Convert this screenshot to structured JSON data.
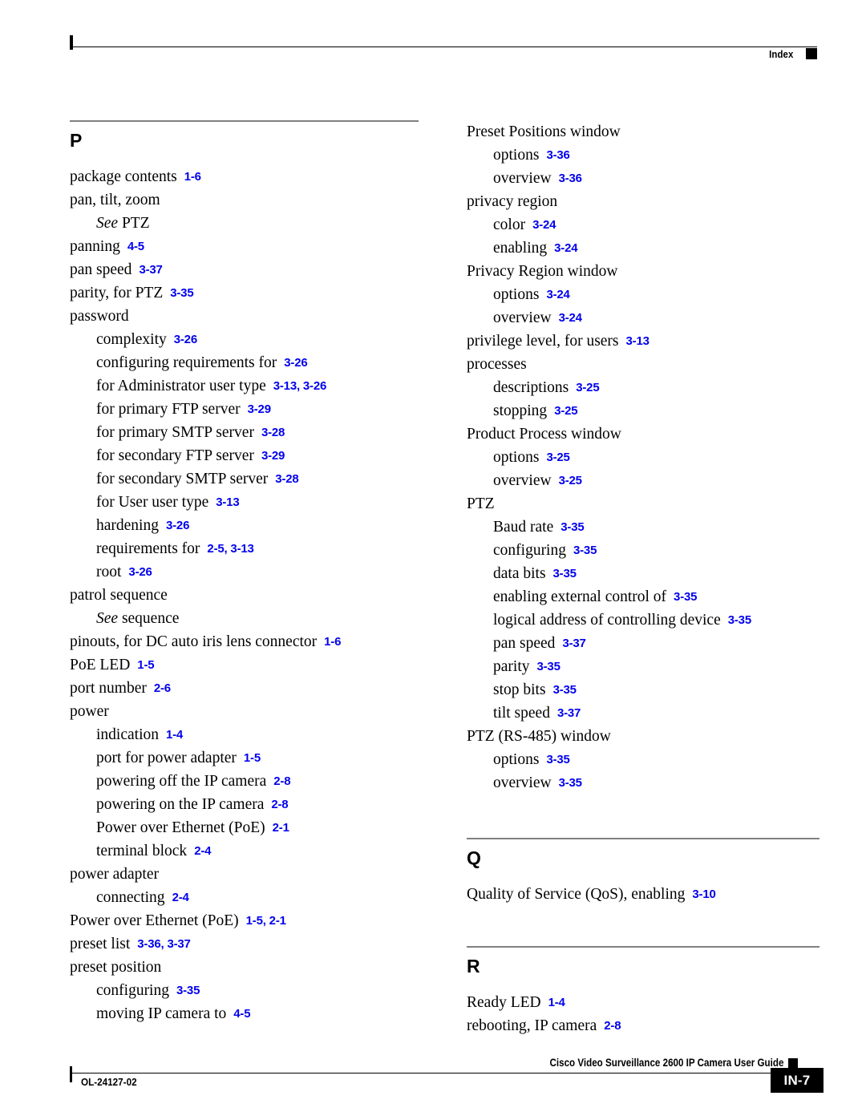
{
  "header": {
    "label": "Index"
  },
  "footer": {
    "doc_id": "OL-24127-02",
    "guide_title": "Cisco Video Surveillance 2600 IP Camera User Guide",
    "page_number": "IN-7"
  },
  "sections": {
    "p": {
      "letter": "P"
    },
    "q": {
      "letter": "Q"
    },
    "r": {
      "letter": "R"
    }
  },
  "left_column": [
    {
      "level": 1,
      "term": "package contents",
      "refs": "1-6"
    },
    {
      "level": 1,
      "term": "pan, tilt, zoom",
      "refs": ""
    },
    {
      "level": 2,
      "see": "See",
      "term": "PTZ",
      "refs": ""
    },
    {
      "level": 1,
      "term": "panning",
      "refs": "4-5"
    },
    {
      "level": 1,
      "term": "pan speed",
      "refs": "3-37"
    },
    {
      "level": 1,
      "term": "parity, for PTZ",
      "refs": "3-35"
    },
    {
      "level": 1,
      "term": "password",
      "refs": ""
    },
    {
      "level": 2,
      "term": "complexity",
      "refs": "3-26"
    },
    {
      "level": 2,
      "term": "configuring requirements for",
      "refs": "3-26"
    },
    {
      "level": 2,
      "term": "for Administrator user type",
      "refs": "3-13, 3-26"
    },
    {
      "level": 2,
      "term": "for primary FTP server",
      "refs": "3-29"
    },
    {
      "level": 2,
      "term": "for primary SMTP server",
      "refs": "3-28"
    },
    {
      "level": 2,
      "term": "for secondary FTP server",
      "refs": "3-29"
    },
    {
      "level": 2,
      "term": "for secondary SMTP server",
      "refs": "3-28"
    },
    {
      "level": 2,
      "term": "for User user type",
      "refs": "3-13"
    },
    {
      "level": 2,
      "term": "hardening",
      "refs": "3-26"
    },
    {
      "level": 2,
      "term": "requirements for",
      "refs": "2-5, 3-13"
    },
    {
      "level": 2,
      "term": "root",
      "refs": "3-26"
    },
    {
      "level": 1,
      "term": "patrol sequence",
      "refs": ""
    },
    {
      "level": 2,
      "see": "See",
      "term": "sequence",
      "refs": ""
    },
    {
      "level": 1,
      "term": "pinouts, for DC auto iris lens connector",
      "refs": "1-6"
    },
    {
      "level": 1,
      "term": "PoE LED",
      "refs": "1-5"
    },
    {
      "level": 1,
      "term": "port number",
      "refs": "2-6"
    },
    {
      "level": 1,
      "term": "power",
      "refs": ""
    },
    {
      "level": 2,
      "term": "indication",
      "refs": "1-4"
    },
    {
      "level": 2,
      "term": "port for power adapter",
      "refs": "1-5"
    },
    {
      "level": 2,
      "term": "powering off the IP camera",
      "refs": "2-8"
    },
    {
      "level": 2,
      "term": "powering on the IP camera",
      "refs": "2-8"
    },
    {
      "level": 2,
      "term": "Power over Ethernet (PoE)",
      "refs": "2-1"
    },
    {
      "level": 2,
      "term": "terminal block",
      "refs": "2-4"
    },
    {
      "level": 1,
      "term": "power adapter",
      "refs": ""
    },
    {
      "level": 2,
      "term": "connecting",
      "refs": "2-4"
    },
    {
      "level": 1,
      "term": "Power over Ethernet (PoE)",
      "refs": "1-5, 2-1"
    },
    {
      "level": 1,
      "term": "preset list",
      "refs": "3-36, 3-37"
    },
    {
      "level": 1,
      "term": "preset position",
      "refs": ""
    },
    {
      "level": 2,
      "term": "configuring",
      "refs": "3-35"
    },
    {
      "level": 2,
      "term": "moving IP camera to",
      "refs": "4-5"
    }
  ],
  "right_column_p": [
    {
      "level": 1,
      "term": "Preset Positions window",
      "refs": ""
    },
    {
      "level": 2,
      "term": "options",
      "refs": "3-36"
    },
    {
      "level": 2,
      "term": "overview",
      "refs": "3-36"
    },
    {
      "level": 1,
      "term": "privacy region",
      "refs": ""
    },
    {
      "level": 2,
      "term": "color",
      "refs": "3-24"
    },
    {
      "level": 2,
      "term": "enabling",
      "refs": "3-24"
    },
    {
      "level": 1,
      "term": "Privacy Region window",
      "refs": ""
    },
    {
      "level": 2,
      "term": "options",
      "refs": "3-24"
    },
    {
      "level": 2,
      "term": "overview",
      "refs": "3-24"
    },
    {
      "level": 1,
      "term": "privilege level, for users",
      "refs": "3-13"
    },
    {
      "level": 1,
      "term": "processes",
      "refs": ""
    },
    {
      "level": 2,
      "term": "descriptions",
      "refs": "3-25"
    },
    {
      "level": 2,
      "term": "stopping",
      "refs": "3-25"
    },
    {
      "level": 1,
      "term": "Product Process window",
      "refs": ""
    },
    {
      "level": 2,
      "term": "options",
      "refs": "3-25"
    },
    {
      "level": 2,
      "term": "overview",
      "refs": "3-25"
    },
    {
      "level": 1,
      "term": "PTZ",
      "refs": ""
    },
    {
      "level": 2,
      "term": "Baud rate",
      "refs": "3-35"
    },
    {
      "level": 2,
      "term": "configuring",
      "refs": "3-35"
    },
    {
      "level": 2,
      "term": "data bits",
      "refs": "3-35"
    },
    {
      "level": 2,
      "term": "enabling external control of",
      "refs": "3-35"
    },
    {
      "level": 2,
      "term": "logical address of controlling device",
      "refs": "3-35"
    },
    {
      "level": 2,
      "term": "pan speed",
      "refs": "3-37"
    },
    {
      "level": 2,
      "term": "parity",
      "refs": "3-35"
    },
    {
      "level": 2,
      "term": "stop bits",
      "refs": "3-35"
    },
    {
      "level": 2,
      "term": "tilt speed",
      "refs": "3-37"
    },
    {
      "level": 1,
      "term": "PTZ (RS-485) window",
      "refs": ""
    },
    {
      "level": 2,
      "term": "options",
      "refs": "3-35"
    },
    {
      "level": 2,
      "term": "overview",
      "refs": "3-35"
    }
  ],
  "right_column_q": [
    {
      "level": 1,
      "term": "Quality of Service (QoS), enabling",
      "refs": "3-10"
    }
  ],
  "right_column_r": [
    {
      "level": 1,
      "term": "Ready LED",
      "refs": "1-4"
    },
    {
      "level": 1,
      "term": "rebooting, IP camera",
      "refs": "2-8"
    }
  ],
  "colors": {
    "reference_link": "#0000EE",
    "letter_rule": "#808080",
    "text": "#000000"
  }
}
